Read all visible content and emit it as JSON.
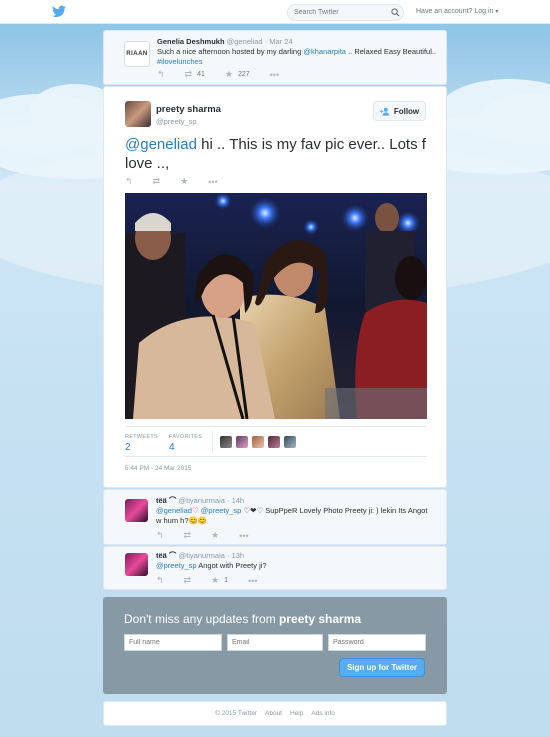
{
  "topbar": {
    "logo": "twitter-bird-icon",
    "search_placeholder": "Search Twitter",
    "account_text": "Have an account? ",
    "login_label": "Log in",
    "caret": "▾"
  },
  "context_tweet": {
    "name": "Genelia Deshmukh",
    "handle": "@geneliad",
    "sep": " · ",
    "time": "Mar 24",
    "text_pre": "Such a nice afternoon hosted by my darling ",
    "mention": "@khanarpita",
    "text_mid": " .. Relaxed Easy Beautiful.. ",
    "hashtag": "#ilovelunches",
    "retweets": "41",
    "favorites": "227",
    "avatar_text": "RIAAN"
  },
  "main_tweet": {
    "name": "preety sharma",
    "handle": "@preety_sp",
    "follow_label": "Follow",
    "mention": "@geneliad",
    "text": " hi .. This is my fav pic ever.. Lots f love ..,",
    "retweets_label": "RETWEETS",
    "retweets_count": "2",
    "favorites_label": "FAVORITES",
    "favorites_count": "4",
    "timestamp": "5:44 PM - 24 Mar 2015"
  },
  "replies": [
    {
      "name": "tëä ⌒",
      "handle": "@tiyanurmaia",
      "sep": " · ",
      "time": "14h",
      "mention1": "@geneliad",
      "heart1": "♡ ",
      "mention2": "@preety_sp",
      "text": " ♡❤♡ SupPpeR Lovely Photo Preety ji: ) lekin Its Angot w hum h?😊😊",
      "favorites": ""
    },
    {
      "name": "tëä ⌒",
      "handle": "@tiyanurmaia",
      "sep": " · ",
      "time": "13h",
      "mention1": "@preety_sp",
      "text": " Angot with Preety ji?",
      "favorites": "1"
    }
  ],
  "signup": {
    "title_pre": "Don't miss any updates from ",
    "title_name": "preety sharma",
    "full_name_placeholder": "Full name",
    "email_placeholder": "Email",
    "password_placeholder": "Password",
    "button_label": "Sign up for Twitter"
  },
  "footer": {
    "copyright": "© 2015 Twitter",
    "about": "About",
    "help": "Help",
    "ads": "Ads info"
  },
  "colors": {
    "accent": "#55acee",
    "link": "#2b7bb9",
    "signup_bg": "#8899a6"
  }
}
